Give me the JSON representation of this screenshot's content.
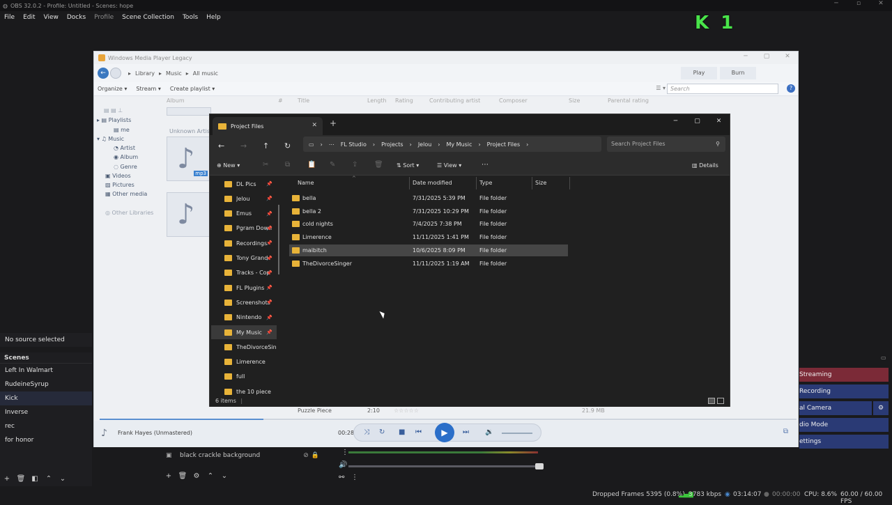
{
  "obs": {
    "title": "OBS 32.0.2 - Profile: Untitled - Scenes: hope",
    "menu": [
      "File",
      "Edit",
      "View",
      "Docks",
      "Profile",
      "Scene Collection",
      "Tools",
      "Help"
    ],
    "overlay_text": "K 1",
    "no_source": "No source selected",
    "scenes_header": "Scenes",
    "scenes": [
      "Left In Walmart",
      "RudeineSyrup",
      "Kick",
      "Inverse",
      "rec",
      "for honor"
    ],
    "selected_scene": "Kick",
    "source_name": "black crackle background",
    "controls": [
      "Streaming",
      "Recording",
      "al Camera",
      "dio Mode",
      "ettings"
    ],
    "status": {
      "dropped": "Dropped Frames 5395 (0.8%)",
      "bitrate": "3783 kbps",
      "stream_time": "03:14:07",
      "rec_time": "00:00:00",
      "cpu": "CPU: 8.6%",
      "fps": "60.00 / 60.00 FPS"
    }
  },
  "wmp": {
    "title": "Windows Media Player Legacy",
    "breadcrumb": [
      "Library",
      "Music",
      "All music"
    ],
    "tabs": [
      "Play",
      "Burn"
    ],
    "toolbar": [
      "Organize",
      "Stream",
      "Create playlist"
    ],
    "search_placeholder": "Search",
    "columns": [
      "Album",
      "#",
      "Title",
      "Length",
      "Rating",
      "Contributing artist",
      "Composer",
      "Size",
      "Parental rating"
    ],
    "sidebar": [
      "Playlists",
      "me",
      "Music",
      "Artist",
      "Album",
      "Genre",
      "Videos",
      "Pictures",
      "Other media",
      "Other Libraries"
    ],
    "unknown_artist": "Unknown Artist",
    "badge": "mp3",
    "track_row": {
      "title": "Puzzle Piece",
      "length": "2:10",
      "size": "21.9 MB"
    },
    "now_playing": "Frank Hayes (Unmastered)",
    "time": "00:28",
    "seek_progress": 0.235
  },
  "explorer": {
    "tab_title": "Project Files",
    "breadcrumb": [
      "FL Studio",
      "Projects",
      "Jelou",
      "My Music",
      "Project Files"
    ],
    "search_placeholder": "Search Project Files",
    "commands": {
      "new": "New",
      "sort": "Sort",
      "view": "View",
      "details": "Details"
    },
    "nav": [
      {
        "label": "DL Pics",
        "pin": true
      },
      {
        "label": "Jelou",
        "pin": true
      },
      {
        "label": "Emus",
        "pin": true
      },
      {
        "label": "Pgram Down",
        "pin": true
      },
      {
        "label": "Recordings",
        "pin": true
      },
      {
        "label": "Tony Grand",
        "pin": true
      },
      {
        "label": "Tracks - Cop",
        "pin": true
      },
      {
        "label": "FL Plugins",
        "pin": true
      },
      {
        "label": "Screenshots",
        "pin": true
      },
      {
        "label": "Nintendo",
        "pin": true
      },
      {
        "label": "My Music",
        "pin": true
      },
      {
        "label": "TheDivorceSing",
        "pin": false
      },
      {
        "label": "Limerence",
        "pin": false
      },
      {
        "label": "full",
        "pin": false
      },
      {
        "label": "the 10 piece",
        "pin": false
      }
    ],
    "selected_nav": "My Music",
    "columns": [
      "Name",
      "Date modified",
      "Type",
      "Size"
    ],
    "files": [
      {
        "name": "bella",
        "date": "7/31/2025 5:39 PM",
        "type": "File folder"
      },
      {
        "name": "bella 2",
        "date": "7/31/2025 10:29 PM",
        "type": "File folder"
      },
      {
        "name": "cold nights",
        "date": "7/4/2025 7:38 PM",
        "type": "File folder"
      },
      {
        "name": "Limerence",
        "date": "11/11/2025 1:41 PM",
        "type": "File folder"
      },
      {
        "name": "maibitch",
        "date": "10/6/2025 8:09 PM",
        "type": "File folder"
      },
      {
        "name": "TheDivorceSinger",
        "date": "11/11/2025 1:19 AM",
        "type": "File folder"
      }
    ],
    "highlighted_row": "maibitch",
    "item_count": "6 items"
  }
}
